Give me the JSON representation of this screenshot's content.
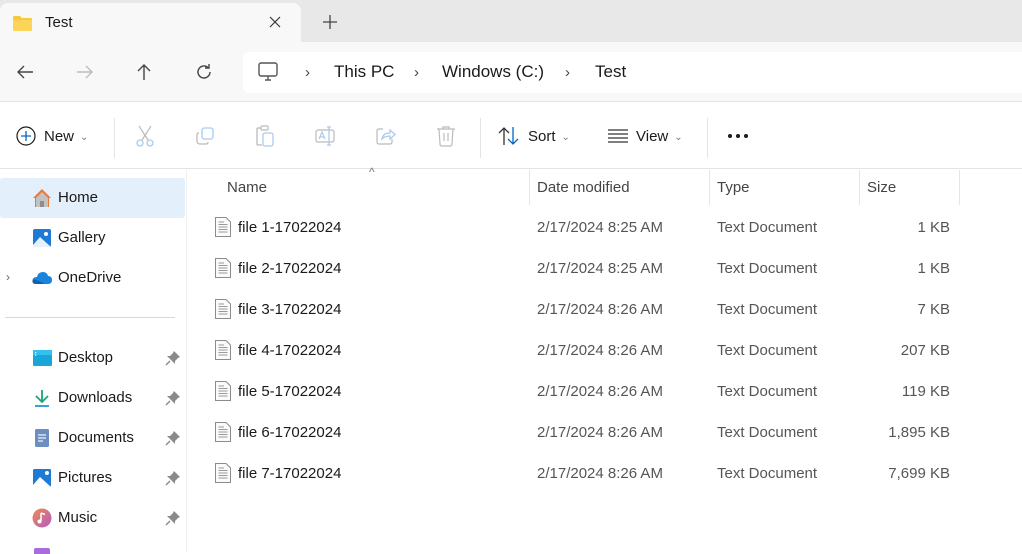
{
  "window": {
    "tab_title": "Test",
    "tab_icon": "folder-icon"
  },
  "nav": {
    "back": "arrow-left-icon",
    "forward": "arrow-right-icon",
    "up": "arrow-up-icon",
    "refresh": "refresh-icon",
    "breadcrumb": [
      {
        "label": "This PC"
      },
      {
        "label": "Windows (C:)"
      },
      {
        "label": "Test"
      }
    ]
  },
  "toolbar": {
    "new_label": "New",
    "sort_label": "Sort",
    "view_label": "View",
    "more_label": "•••",
    "actions": [
      "cut",
      "copy",
      "paste",
      "rename",
      "share",
      "delete"
    ]
  },
  "sidebar": {
    "items": [
      {
        "label": "Home",
        "icon": "home-icon",
        "selected": true
      },
      {
        "label": "Gallery",
        "icon": "gallery-icon"
      },
      {
        "label": "OneDrive",
        "icon": "onedrive-icon",
        "expandable": true
      },
      {
        "label": "Desktop",
        "icon": "desktop-icon",
        "pinned": true
      },
      {
        "label": "Downloads",
        "icon": "downloads-icon",
        "pinned": true
      },
      {
        "label": "Documents",
        "icon": "documents-icon",
        "pinned": true
      },
      {
        "label": "Pictures",
        "icon": "pictures-icon",
        "pinned": true
      },
      {
        "label": "Music",
        "icon": "music-icon",
        "pinned": true
      }
    ]
  },
  "filelist": {
    "columns": [
      "Name",
      "Date modified",
      "Type",
      "Size"
    ],
    "sorted_by": "Name",
    "rows": [
      {
        "name": "file 1-17022024",
        "date": "2/17/2024 8:25 AM",
        "type": "Text Document",
        "size": "1 KB"
      },
      {
        "name": "file 2-17022024",
        "date": "2/17/2024 8:25 AM",
        "type": "Text Document",
        "size": "1 KB"
      },
      {
        "name": "file 3-17022024",
        "date": "2/17/2024 8:26 AM",
        "type": "Text Document",
        "size": "7 KB"
      },
      {
        "name": "file 4-17022024",
        "date": "2/17/2024 8:26 AM",
        "type": "Text Document",
        "size": "207 KB"
      },
      {
        "name": "file 5-17022024",
        "date": "2/17/2024 8:26 AM",
        "type": "Text Document",
        "size": "119 KB"
      },
      {
        "name": "file 6-17022024",
        "date": "2/17/2024 8:26 AM",
        "type": "Text Document",
        "size": "1,895 KB"
      },
      {
        "name": "file 7-17022024",
        "date": "2/17/2024 8:26 AM",
        "type": "Text Document",
        "size": "7,699 KB"
      }
    ]
  },
  "colors": {
    "accent": "#0067c0",
    "selected_bg": "#e3effb",
    "disabled_icon": "#a9cbee"
  }
}
